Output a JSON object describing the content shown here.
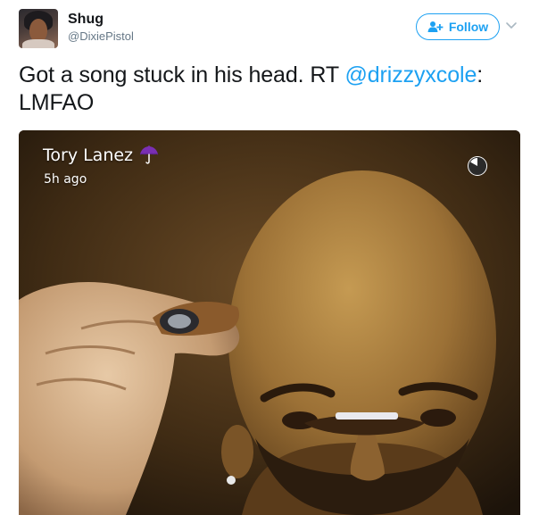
{
  "tweet": {
    "author": {
      "display_name": "Shug",
      "screen_name": "@DixiePistol",
      "avatar": "user-avatar-photo"
    },
    "follow_button": {
      "label": "Follow",
      "icon": "add-user-icon"
    },
    "menu_icon": "chevron-down-icon",
    "text": {
      "body": "Got a song stuck in his head. RT ",
      "mention": "@drizzyxcole",
      "tail": ": LMFAO"
    },
    "media": {
      "snap_username": "Tory Lanez",
      "snap_username_icon": "purple-umbrella-icon",
      "snap_time": "5h ago",
      "timer_icon": "snap-timer-icon"
    },
    "colors": {
      "link": "#1da1f2",
      "text": "#14171a",
      "secondary": "#657786"
    }
  }
}
